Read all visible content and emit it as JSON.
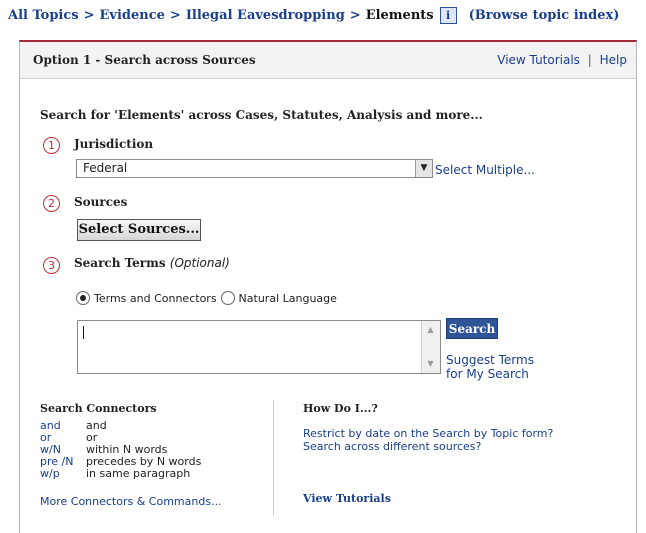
{
  "breadcrumb": {
    "items": [
      "All Topics",
      "Evidence",
      "Illegal Eavesdropping"
    ],
    "separator": ">",
    "current": "Elements",
    "info_icon": "i",
    "browse": "(Browse topic index)"
  },
  "panel": {
    "title": "Option 1 - Search across Sources",
    "links": {
      "tutorials": "View Tutorials",
      "separator": "|",
      "help": "Help"
    },
    "lead": "Search for 'Elements' across Cases, Statutes, Analysis and more..."
  },
  "steps": {
    "jurisdiction": {
      "number": "1",
      "label": "Jurisdiction",
      "selected": "Federal",
      "select_multiple": "Select Multiple..."
    },
    "sources": {
      "number": "2",
      "label": "Sources",
      "button": "Select Sources..."
    },
    "search_terms": {
      "number": "3",
      "label": "Search Terms",
      "optional": "(Optional)",
      "radio_terms": "Terms and Connectors",
      "radio_natural": "Natural Language",
      "selected_mode": "terms",
      "value": "",
      "search_button": "Search",
      "suggest_line1": "Suggest Terms",
      "suggest_line2": "for My Search"
    }
  },
  "connectors": {
    "title": "Search Connectors",
    "rows": [
      {
        "key": "and",
        "desc": "and"
      },
      {
        "key": "or",
        "desc": "or"
      },
      {
        "key": "w/N",
        "desc": "within N words"
      },
      {
        "key": "pre /N",
        "desc": "precedes by N words"
      },
      {
        "key": "w/p",
        "desc": "in same paragraph"
      }
    ],
    "more": "More Connectors & Commands..."
  },
  "how_do_i": {
    "title": "How Do I...?",
    "links": [
      "Restrict by date on the Search by Topic form?",
      "Search across different sources?"
    ],
    "view_tutorials": "View Tutorials"
  },
  "colors": {
    "link": "#1a3f8c",
    "accent_border": "#a3293a",
    "step_number": "#c03030",
    "search_button": "#2e5596"
  },
  "icons": [
    "info-icon",
    "chevron-down-icon",
    "radio-selected-icon",
    "radio-unselected-icon",
    "scroll-up-icon",
    "scroll-down-icon"
  ]
}
